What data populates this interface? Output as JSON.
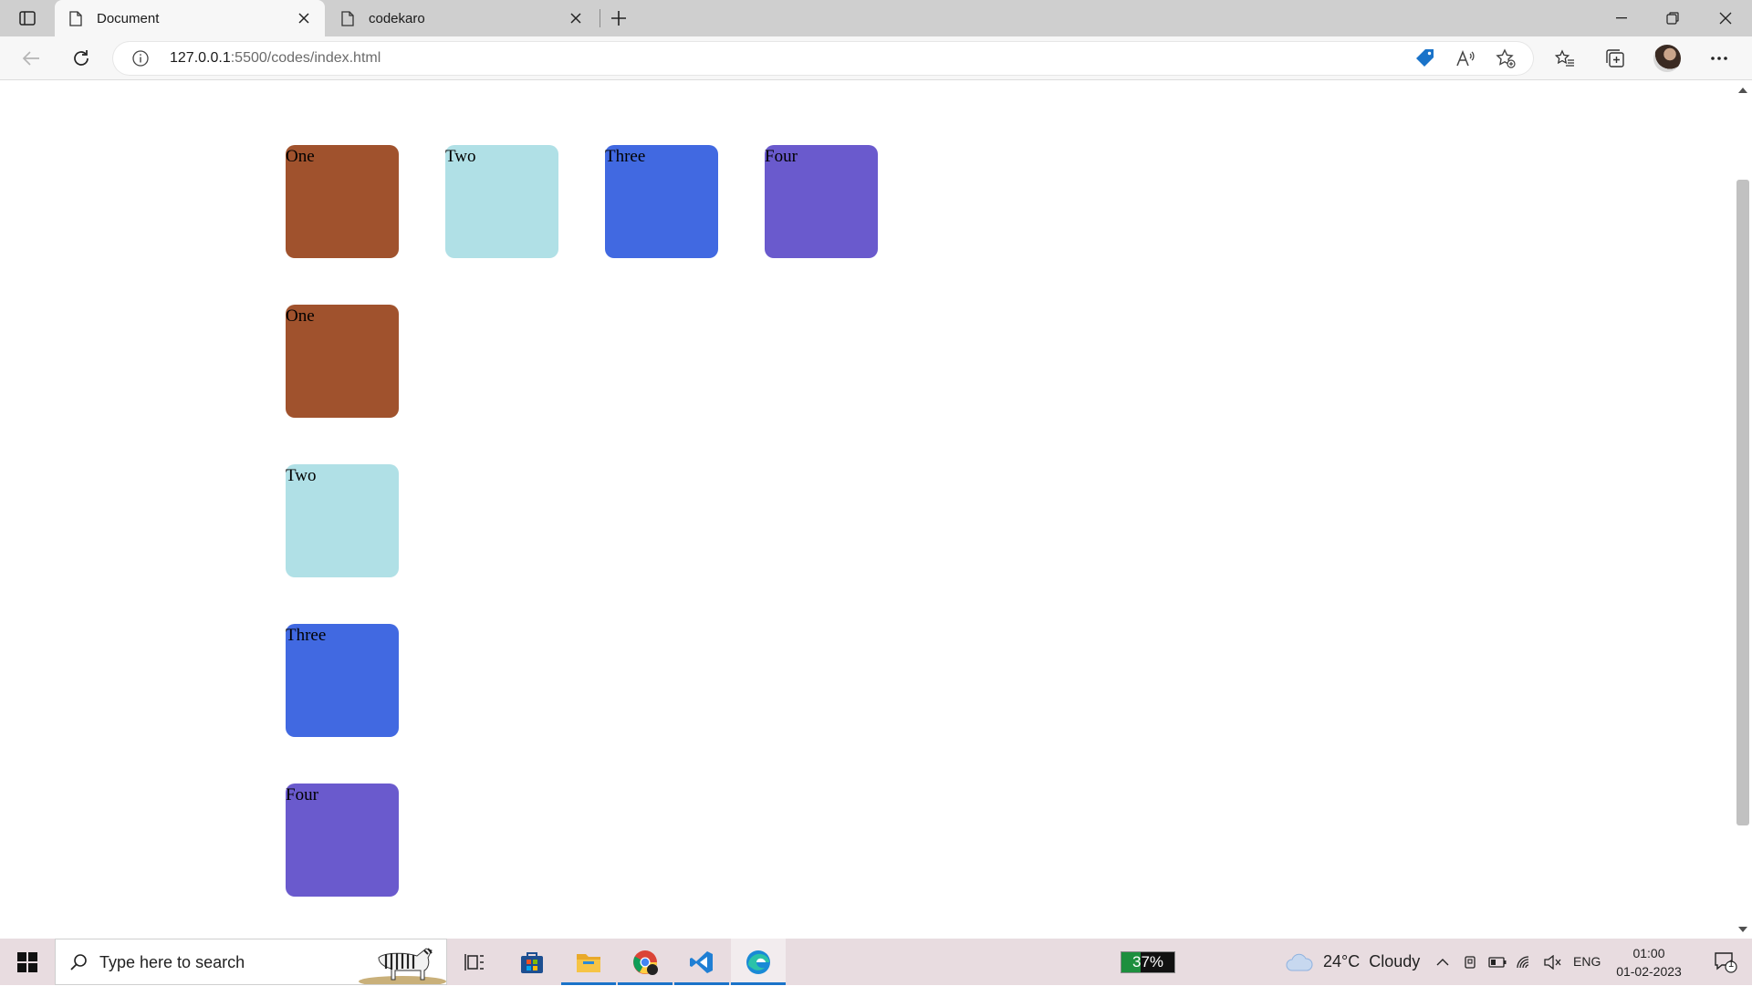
{
  "browser": {
    "tabs": [
      {
        "title": "Document",
        "active": true
      },
      {
        "title": "codekaro",
        "active": false
      }
    ],
    "url": {
      "host": "127.0.0.1",
      "path": ":5500/codes/index.html"
    }
  },
  "page": {
    "boxes": [
      {
        "label": "One",
        "color": "#a0522d"
      },
      {
        "label": "Two",
        "color": "#b0e0e6"
      },
      {
        "label": "Three",
        "color": "#4169e1"
      },
      {
        "label": "Four",
        "color": "#6a5acd"
      },
      {
        "label": "One",
        "color": "#a0522d"
      },
      {
        "label": "Two",
        "color": "#b0e0e6"
      },
      {
        "label": "Three",
        "color": "#4169e1"
      },
      {
        "label": "Four",
        "color": "#6a5acd"
      }
    ]
  },
  "taskbar": {
    "search_placeholder": "Type here to search",
    "battery_percent": "37%",
    "battery_level": 0.37,
    "weather": {
      "temp": "24°C",
      "condition": "Cloudy"
    },
    "language": "ENG",
    "time": "01:00",
    "date": "01-02-2023",
    "notification_count": "1"
  },
  "colors": {
    "taskbar_bg": "#e8dce0",
    "accent": "#1a73c9"
  }
}
